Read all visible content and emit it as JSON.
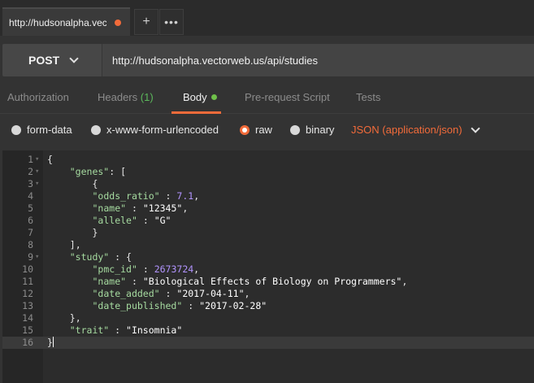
{
  "tab": {
    "title": "http://hudsonalpha.vectorweb.us/api/studies",
    "add_label": "+",
    "more_label": "•••"
  },
  "request": {
    "method": "POST",
    "url": "http://hudsonalpha.vectorweb.us/api/studies"
  },
  "req_tabs": [
    {
      "label": "Authorization"
    },
    {
      "label": "Headers",
      "count": "(1)"
    },
    {
      "label": "Body"
    },
    {
      "label": "Pre-request Script"
    },
    {
      "label": "Tests"
    }
  ],
  "body_types": [
    {
      "label": "form-data",
      "selected": false
    },
    {
      "label": "x-www-form-urlencoded",
      "selected": false
    },
    {
      "label": "raw",
      "selected": true
    },
    {
      "label": "binary",
      "selected": false
    }
  ],
  "content_type": "JSON (application/json)",
  "editor": {
    "lines": [
      "{",
      "    \"genes\": [",
      "        {",
      "        \"odds_ratio\" : 7.1,",
      "        \"name\" : \"12345\",",
      "        \"allele\" : \"G\"",
      "        }",
      "    ],",
      "    \"study\" : {",
      "        \"pmc_id\" : 2673724,",
      "        \"name\" : \"Biological Effects of Biology on Programmers\",",
      "        \"date_added\" : \"2017-04-11\",",
      "        \"date_published\" : \"2017-02-28\"",
      "    },",
      "    \"trait\" : \"Insomnia\"",
      "}"
    ],
    "foldable_lines": [
      1,
      2,
      3,
      9
    ],
    "active_line": 16
  },
  "colors": {
    "accent": "#f26b3a",
    "success": "#6fc04a",
    "key": "#a6dba0",
    "number": "#b294ff"
  }
}
